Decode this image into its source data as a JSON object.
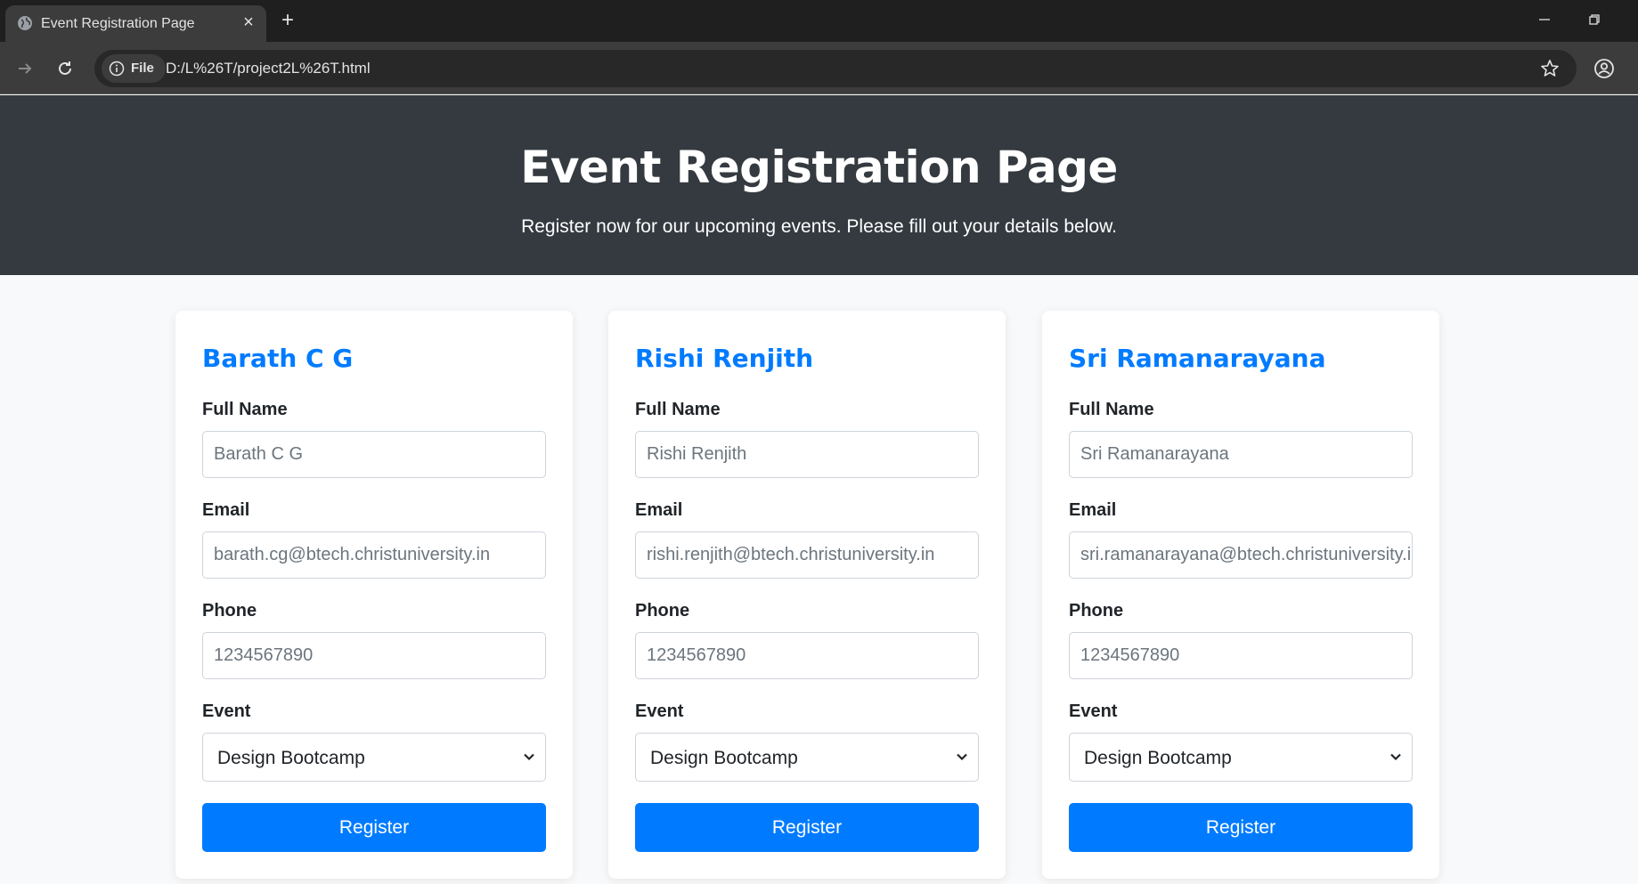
{
  "browser": {
    "tab_title": "Event Registration Page",
    "chip_label": "File",
    "url": "D:/L%26T/project2L%26T.html"
  },
  "hero": {
    "title": "Event Registration Page",
    "subtitle": "Register now for our upcoming events. Please fill out your details below."
  },
  "cards": [
    {
      "title": "Barath C G",
      "name_label": "Full Name",
      "name_value": "Barath C G",
      "email_label": "Email",
      "email_value": "barath.cg@btech.christuniversity.in",
      "phone_label": "Phone",
      "phone_value": "1234567890",
      "event_label": "Event",
      "event_value": "Design Bootcamp",
      "button": "Register"
    },
    {
      "title": "Rishi Renjith",
      "name_label": "Full Name",
      "name_value": "Rishi Renjith",
      "email_label": "Email",
      "email_value": "rishi.renjith@btech.christuniversity.in",
      "phone_label": "Phone",
      "phone_value": "1234567890",
      "event_label": "Event",
      "event_value": "Design Bootcamp",
      "button": "Register"
    },
    {
      "title": "Sri Ramanarayana",
      "name_label": "Full Name",
      "name_value": "Sri Ramanarayana",
      "email_label": "Email",
      "email_value": "sri.ramanarayana@btech.christuniversity.in",
      "phone_label": "Phone",
      "phone_value": "1234567890",
      "event_label": "Event",
      "event_value": "Design Bootcamp",
      "button": "Register"
    }
  ],
  "colors": {
    "accent": "#007bff",
    "hero_bg": "#343a40",
    "page_bg": "#f8f9fa"
  },
  "icons": [
    "globe-icon",
    "close-icon",
    "plus-icon",
    "minimize-icon",
    "restore-icon",
    "forward-icon",
    "reload-icon",
    "info-icon",
    "star-icon",
    "profile-icon",
    "chevron-down-icon"
  ]
}
